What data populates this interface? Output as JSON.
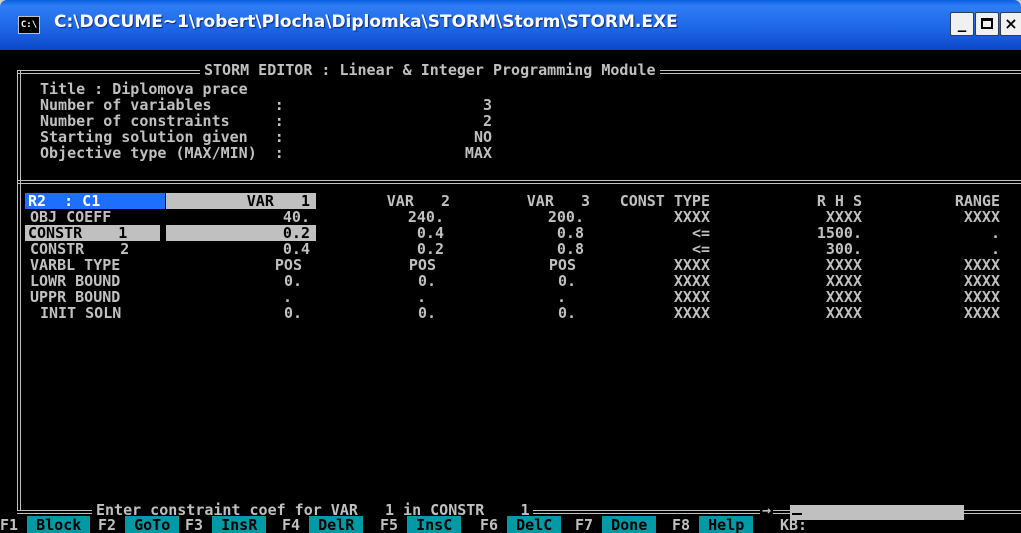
{
  "window": {
    "title": "C:\\DOCUME~1\\robert\\Plocha\\Diplomka\\STORM\\Storm\\STORM.EXE",
    "icon": "console-icon",
    "buttons": {
      "minimize": "_",
      "maximize": "□",
      "close": "×"
    }
  },
  "header": {
    "banner": "STORM EDITOR : Linear & Integer Programming Module",
    "fields": [
      {
        "label": "Title : Diplomova prace",
        "value": ""
      },
      {
        "label": "Number of variables       :",
        "value": "3"
      },
      {
        "label": "Number of constraints     :",
        "value": "2"
      },
      {
        "label": "Starting solution given   :",
        "value": "NO"
      },
      {
        "label": "Objective type (MAX/MIN)  :",
        "value": "MAX"
      }
    ]
  },
  "grid": {
    "position": "R2  : C1",
    "columns": [
      "VAR   1",
      "VAR   2",
      "VAR   3",
      "CONST TYPE",
      "R H S",
      "RANGE"
    ],
    "rows": [
      {
        "label": "OBJ COEFF",
        "cells": [
          "40.",
          "240.",
          "200.",
          "XXXX",
          "XXXX",
          "XXXX"
        ]
      },
      {
        "label": "CONSTR    1",
        "cells": [
          "0.2",
          "0.4",
          "0.8",
          "<=",
          "1500.",
          "."
        ]
      },
      {
        "label": "CONSTR    2",
        "cells": [
          "0.4",
          "0.2",
          "0.8",
          "<=",
          "300.",
          "."
        ]
      },
      {
        "label": "VARBL TYPE",
        "cells": [
          "POS",
          "POS",
          "POS",
          "XXXX",
          "XXXX",
          "XXXX"
        ]
      },
      {
        "label": "LOWR BOUND",
        "cells": [
          "0.",
          "0.",
          "0.",
          "XXXX",
          "XXXX",
          "XXXX"
        ]
      },
      {
        "label": "UPPR BOUND",
        "cells": [
          ".",
          ".",
          ".",
          "XXXX",
          "XXXX",
          "XXXX"
        ]
      },
      {
        "label": "INIT SOLN",
        "cells": [
          "0.",
          "0.",
          "0.",
          "XXXX",
          "XXXX",
          "XXXX"
        ]
      }
    ]
  },
  "status": {
    "prompt": "Enter constraint coef for VAR   1 in CONSTR    1",
    "input_value": ""
  },
  "fkeys": [
    {
      "key": "F1",
      "label": "Block"
    },
    {
      "key": "F2",
      "label": "GoTo"
    },
    {
      "key": "F3",
      "label": "InsR"
    },
    {
      "key": "F4",
      "label": "DelR"
    },
    {
      "key": "F5",
      "label": "InsC"
    },
    {
      "key": "F6",
      "label": "DelC"
    },
    {
      "key": "F7",
      "label": "Done"
    },
    {
      "key": "F8",
      "label": "Help"
    }
  ],
  "kb_label": "KB:",
  "colors": {
    "console_bg": "#000000",
    "console_fg": "#c0c0c0",
    "highlight": "#c0c0c0",
    "position_indicator": "#1e6fff",
    "fkey_bar": "#009aa6",
    "titlebar": "#1c64e4"
  }
}
